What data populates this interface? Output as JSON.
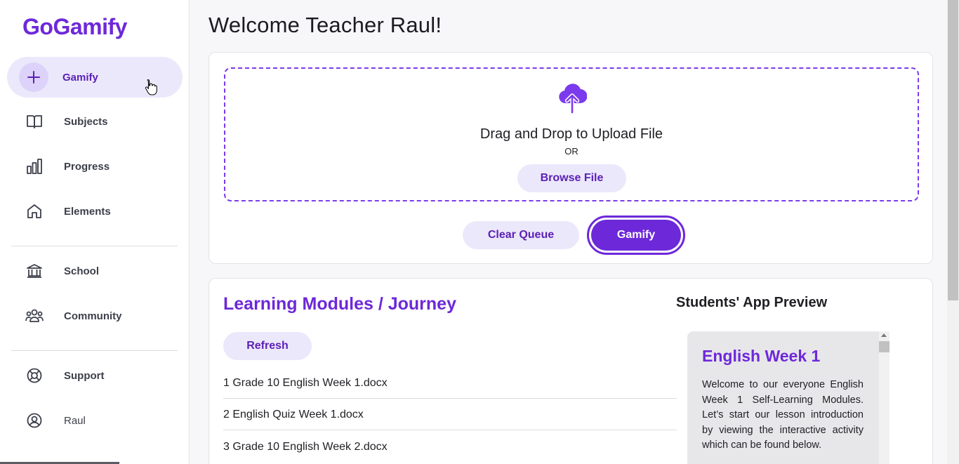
{
  "app": {
    "logo": "GoGamify"
  },
  "sidebar": {
    "items": [
      {
        "label": "Gamify",
        "icon": "plus-icon",
        "active": true
      },
      {
        "label": "Subjects",
        "icon": "book-icon"
      },
      {
        "label": "Progress",
        "icon": "bar-chart-icon"
      },
      {
        "label": "Elements",
        "icon": "home-icon"
      },
      {
        "label": "School",
        "icon": "bank-icon"
      },
      {
        "label": "Community",
        "icon": "users-icon"
      },
      {
        "label": "Support",
        "icon": "lifebuoy-icon"
      },
      {
        "label": "Raul",
        "icon": "user-circle-icon"
      }
    ]
  },
  "main": {
    "title": "Welcome Teacher Raul!",
    "upload": {
      "drop_text": "Drag and Drop to Upload File",
      "or_text": "OR",
      "browse_label": "Browse File",
      "clear_label": "Clear Queue",
      "gamify_label": "Gamify",
      "icon": "cloud-upload-icon"
    },
    "modules": {
      "title": "Learning Modules / Journey",
      "refresh_label": "Refresh",
      "items": [
        "1 Grade 10 English Week 1.docx",
        "2 English Quiz Week 1.docx",
        "3 Grade 10 English Week 2.docx"
      ]
    },
    "preview": {
      "title": "Students' App Preview",
      "card_title": "English Week 1",
      "card_text": "Welcome to our everyone English Week 1 Self-Learning Modules. Let’s start our lesson introduction by viewing the interactive activity which can be found below."
    }
  },
  "colors": {
    "accent": "#6d28d9",
    "accent_soft": "#ece8fb"
  }
}
